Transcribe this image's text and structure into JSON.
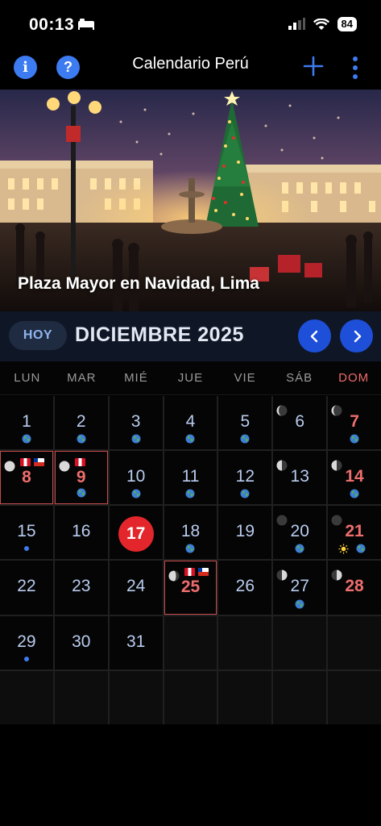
{
  "status_bar": {
    "time": "00:13",
    "battery": "84"
  },
  "nav": {
    "title": "Calendario Perú",
    "info_label": "i",
    "help_label": "?"
  },
  "hero": {
    "caption": "Plaza Mayor en Navidad, Lima"
  },
  "month": {
    "today_label": "HOY",
    "title": "DICIEMBRE 2025"
  },
  "weekdays": [
    "LUN",
    "MAR",
    "MIÉ",
    "JUE",
    "VIE",
    "SÁB",
    "DOM"
  ],
  "days": [
    {
      "n": "1",
      "marker": "globe"
    },
    {
      "n": "2",
      "marker": "globe"
    },
    {
      "n": "3",
      "marker": "globe"
    },
    {
      "n": "4",
      "marker": "globe"
    },
    {
      "n": "5",
      "marker": "globe"
    },
    {
      "n": "6",
      "moon": "waning",
      "marker": ""
    },
    {
      "n": "7",
      "moon": "waning",
      "marker": "globe",
      "sunday": true
    },
    {
      "n": "8",
      "moon": "full",
      "flags": [
        "pe",
        "cl"
      ],
      "holiday": true
    },
    {
      "n": "9",
      "moon": "full",
      "flags": [
        "pe"
      ],
      "holiday": true,
      "marker": "globe"
    },
    {
      "n": "10",
      "marker": "globe"
    },
    {
      "n": "11",
      "marker": "globe"
    },
    {
      "n": "12",
      "marker": "globe"
    },
    {
      "n": "13",
      "moon": "half"
    },
    {
      "n": "14",
      "moon": "half",
      "marker": "globe",
      "sunday": true
    },
    {
      "n": "15",
      "marker": "dot"
    },
    {
      "n": "16"
    },
    {
      "n": "17",
      "today": true
    },
    {
      "n": "18",
      "marker": "globe"
    },
    {
      "n": "19"
    },
    {
      "n": "20",
      "moon": "new",
      "marker": "globe"
    },
    {
      "n": "21",
      "moon": "new",
      "marker": "sun-globe",
      "sunday": true
    },
    {
      "n": "22"
    },
    {
      "n": "23"
    },
    {
      "n": "24"
    },
    {
      "n": "25",
      "moon": "crescent",
      "flags": [
        "pe",
        "cl"
      ],
      "holiday": true
    },
    {
      "n": "26"
    },
    {
      "n": "27",
      "moon": "first",
      "marker": "globe"
    },
    {
      "n": "28",
      "moon": "first",
      "sunday": true
    },
    {
      "n": "29",
      "marker": "dot"
    },
    {
      "n": "30"
    },
    {
      "n": "31"
    }
  ],
  "colors": {
    "accent": "#3d7bf0",
    "today": "#e3262b",
    "holiday": "#ee6d6d"
  }
}
